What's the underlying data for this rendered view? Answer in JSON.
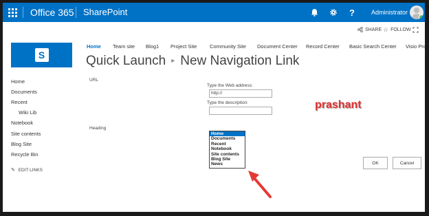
{
  "suite": {
    "brand": "Office 365",
    "app": "SharePoint",
    "user": "Administrator"
  },
  "actions": {
    "share": "SHARE",
    "follow": "FOLLOW"
  },
  "topnav": [
    "Home",
    "Team site",
    "Blog1",
    "Project Site",
    "Community Site",
    "Document Center",
    "Record Center",
    "Basic Search Center",
    "Visio Proce"
  ],
  "title": {
    "part1": "Quick Launch",
    "part2": "New Navigation Link"
  },
  "quicklaunch": [
    "Home",
    "Documents",
    "Recent",
    "Wiki Lib",
    "Notebook",
    "Site contents",
    "Blog Site",
    "Recycle Bin"
  ],
  "edit_links": "EDIT LINKS",
  "form": {
    "url_label": "URL",
    "web_address_label": "Type the Web address:",
    "web_address_value": "http://",
    "description_label": "Type the description:",
    "description_value": "",
    "heading_label": "Heading",
    "heading_options": [
      "Home",
      "Documents",
      "Recent",
      "Notebook",
      "Site contents",
      "Blog Site",
      "News"
    ],
    "heading_selected": "Home"
  },
  "buttons": {
    "ok": "OK",
    "cancel": "Cancel"
  },
  "watermark": "prashant",
  "colors": {
    "suite_bar": "#0072c6",
    "arrow": "#e53935",
    "watermark": "#e03030"
  }
}
